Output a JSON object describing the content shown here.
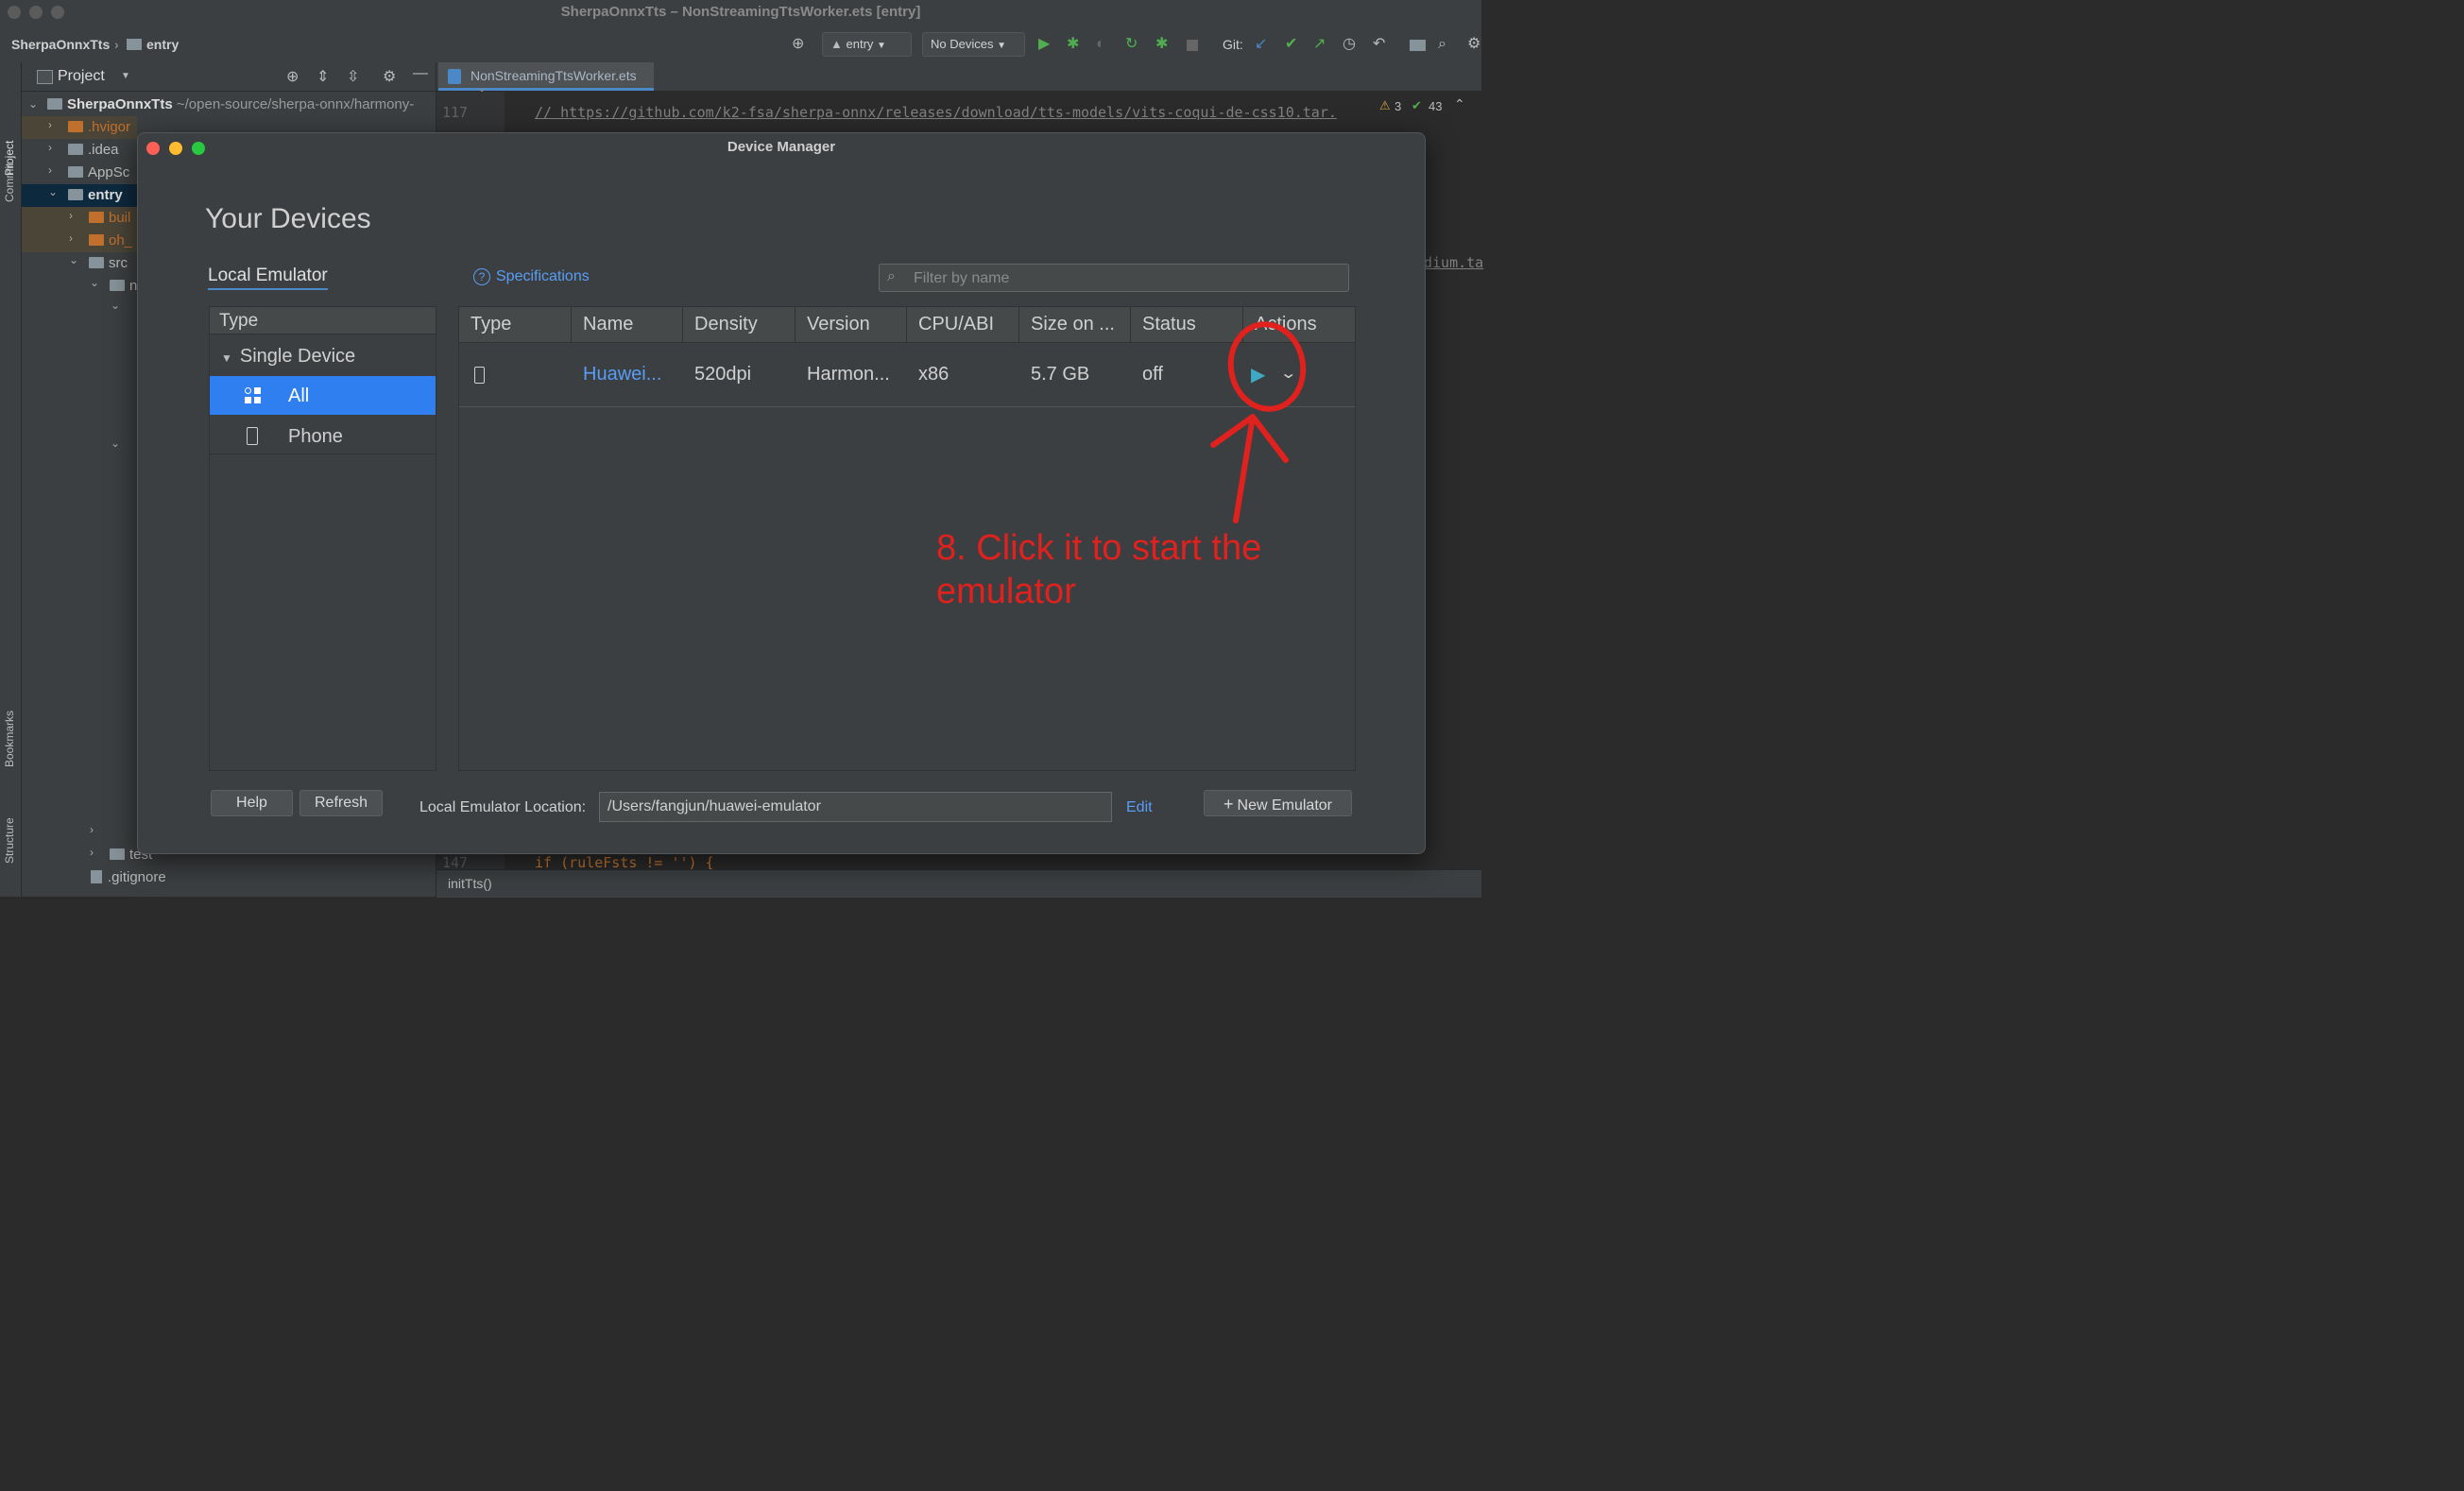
{
  "window": {
    "title": "SherpaOnnxTts – NonStreamingTtsWorker.ets [entry]"
  },
  "toolbar": {
    "project": "SherpaOnnxTts",
    "module": "entry",
    "run_config": "entry",
    "device": "No Devices",
    "git_label": "Git:"
  },
  "left_strip": {
    "project": "Project",
    "commit": "Commit",
    "bookmarks": "Bookmarks",
    "structure": "Structure"
  },
  "project_panel": {
    "title": "Project",
    "root_name": "SherpaOnnxTts",
    "root_path": "~/open-source/sherpa-onnx/harmony-",
    "items": [
      ".hvigor",
      ".idea",
      "AppSc",
      "entry",
      "buil",
      "oh_",
      "src",
      "n",
      "test",
      ".gitignore"
    ]
  },
  "editor": {
    "tab": "NonStreamingTtsWorker.ets",
    "line_top": "117",
    "code_top": "// https://github.com/k2-fsa/sherpa-onnx/releases/download/tts-models/vits-coqui-de-css10.tar.",
    "warnings": "3",
    "checks": "43",
    "right_fragment": "dium.ta",
    "line_bottom": "147",
    "code_bottom": "if (ruleFsts != '') {",
    "breadcrumb": "initTts()"
  },
  "dialog": {
    "title": "Device Manager",
    "heading": "Your Devices",
    "local_tab": "Local Emulator",
    "specifications": "Specifications",
    "filter_placeholder": "Filter by name",
    "type_panel": {
      "header": "Type",
      "group": "Single Device",
      "items": [
        {
          "label": "All",
          "icon": "grid-icon",
          "selected": true
        },
        {
          "label": "Phone",
          "icon": "phone-icon",
          "selected": false
        }
      ]
    },
    "table": {
      "columns": [
        "Type",
        "Name",
        "Density",
        "Version",
        "CPU/ABI",
        "Size on ...",
        "Status",
        "Actions"
      ],
      "rows": [
        {
          "type_icon": "phone-icon",
          "name": "Huawei...",
          "density": "520dpi",
          "version": "Harmon...",
          "cpu": "x86",
          "size": "5.7 GB",
          "status": "off"
        }
      ]
    },
    "help": "Help",
    "refresh": "Refresh",
    "location_label": "Local Emulator Location:",
    "location_value": "/Users/fangjun/huawei-emulator",
    "edit": "Edit",
    "new_emulator": "New Emulator"
  },
  "annotation": {
    "text": "8. Click it to start the emulator",
    "color": "#e0211d"
  },
  "colors": {
    "accent": "#4a88c7",
    "selection": "#2f7ff0",
    "link": "#589df6",
    "run_green": "#4fae4f",
    "play_teal": "#3fa8c4"
  }
}
